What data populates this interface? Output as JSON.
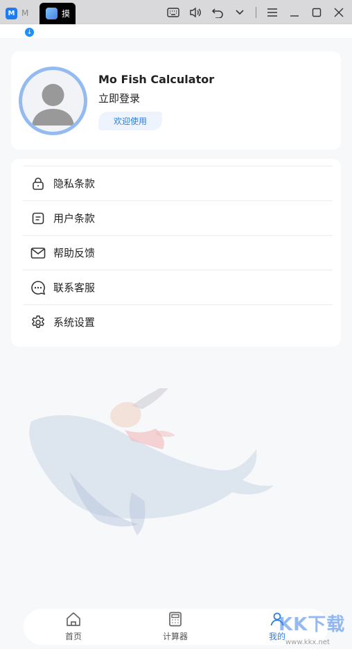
{
  "titlebar": {
    "tab1_label": "M",
    "tab2_label": "摸",
    "tools": [
      "keyboard-icon",
      "volume-icon",
      "undo-icon",
      "chevron-down-icon",
      "menu-icon",
      "minimize-icon",
      "maximize-icon",
      "close-icon"
    ]
  },
  "profile": {
    "app_name": "Mo Fish Calculator",
    "login_label": "立即登录",
    "welcome_label": "欢迎使用"
  },
  "menu": {
    "items": [
      {
        "label": "隐私条款",
        "icon": "lock-icon"
      },
      {
        "label": "用户条款",
        "icon": "document-icon"
      },
      {
        "label": "帮助反馈",
        "icon": "mail-icon"
      },
      {
        "label": "联系客服",
        "icon": "chat-icon"
      },
      {
        "label": "系统设置",
        "icon": "gear-icon"
      }
    ]
  },
  "bottom_nav": {
    "items": [
      {
        "label": "首页",
        "icon": "home-icon",
        "active": false
      },
      {
        "label": "计算器",
        "icon": "calculator-icon",
        "active": false
      },
      {
        "label": "我的",
        "icon": "user-icon",
        "active": true
      }
    ]
  },
  "watermark": {
    "text": "KK下载",
    "url": "www.kkx.net"
  },
  "colors": {
    "accent": "#2f7de1",
    "avatar_ring": "#93bbf0",
    "background": "#f7f8fa"
  }
}
